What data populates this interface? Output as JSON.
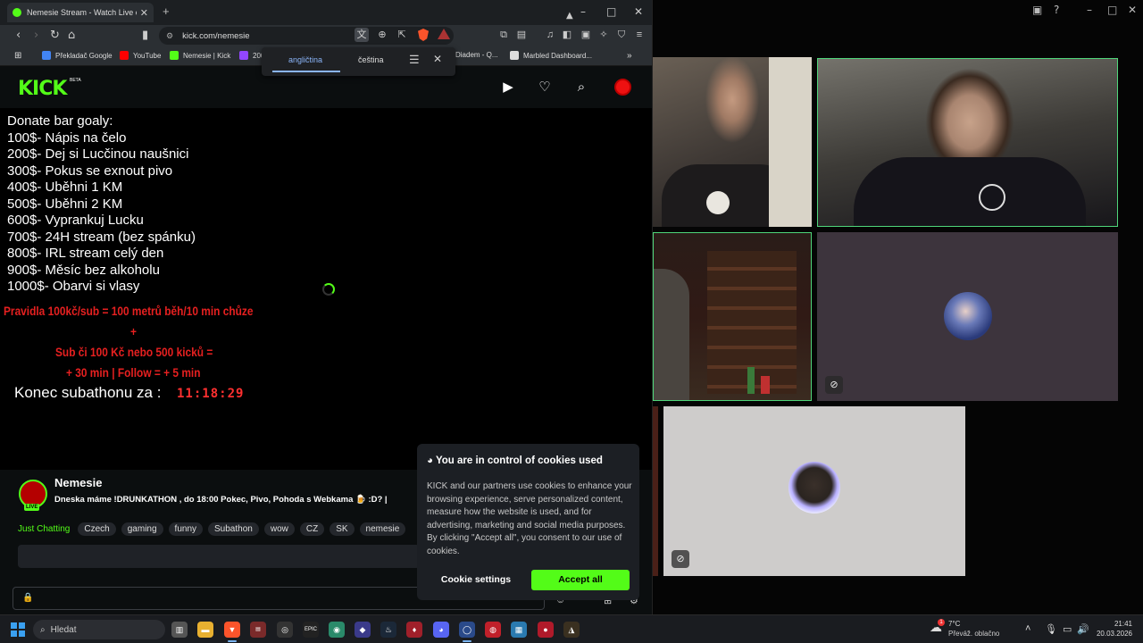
{
  "browser": {
    "tab_title": "Nemesie Stream - Watch Live on Kick",
    "url": "kick.com/nemesie",
    "bookmarks": [
      "Překladač Google",
      "YouTube",
      "Nemesie | Kick",
      "200",
      "Diadem - Q...",
      "Marbled Dashboard..."
    ]
  },
  "translate_popup": {
    "lang_from": "angličtina",
    "lang_to": "čeština"
  },
  "kick": {
    "logo": "KICK",
    "beta": "BETA"
  },
  "stream_overlay": {
    "goals_title": "Donate bar goaly:",
    "goals": [
      "100$- Nápis na čelo",
      "200$- Dej si Lucčinou naušnici",
      "300$- Pokus se exnout pivo",
      "400$- Uběhni 1 KM",
      "500$- Uběhni 2 KM",
      "600$- Vyprankuj Lucku",
      "700$- 24H stream (bez spánku)",
      "800$-  IRL stream celý den",
      "900$- Měsíc bez alkoholu",
      "1000$- Obarvi si vlasy"
    ],
    "rules_line1": "Pravidla 100kč/sub = 100 metrů běh/10 min chůze",
    "rules_plus": "+",
    "rules_line2": "Sub či 100 Kč nebo 500 kicků =",
    "rules_line3": "+ 30 min | Follow = + 5 min",
    "timer_label": "Konec subathonu za :",
    "timer_value": "11:18:29"
  },
  "channel": {
    "name": "Nemesie",
    "live_badge": "LIVE",
    "title": "Dneska máme !DRUNKATHON , do 18:00 Pokec, Pivo, Pohoda s Webkama 🍺 :D? |",
    "category": "Just Chatting",
    "tags": [
      "Czech",
      "gaming",
      "funny",
      "Subathon",
      "wow",
      "CZ",
      "SK",
      "nemesie"
    ]
  },
  "cookie": {
    "title": "You are in control of cookies used",
    "body": "KICK and our partners use cookies to enhance your browsing experience, serve personalized content, measure how the website is used, and for advertising, marketing and social media purposes. By clicking \"Accept all\", you consent to our use of cookies.",
    "settings_label": "Cookie settings",
    "accept_label": "Accept all"
  },
  "taskbar": {
    "search_placeholder": "Hledat",
    "temperature": "7°C",
    "weather": "Převáž. oblačno",
    "weather_badge": "1",
    "time": "21:41",
    "date": "20.03.2026"
  },
  "colors": {
    "kick_green": "#53fc18",
    "overlay_red": "#e62020",
    "call_active_border": "#4fd67a"
  }
}
